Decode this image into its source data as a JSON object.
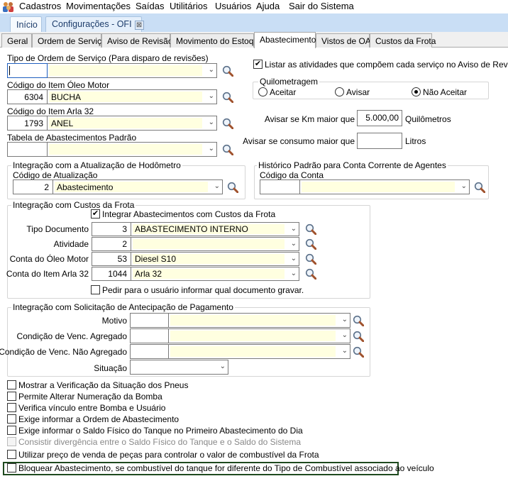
{
  "menu": {
    "items": [
      "Cadastros",
      "Movimentações",
      "Saídas",
      "Utilitários",
      "Usuários",
      "Ajuda",
      "Sair do Sistema"
    ]
  },
  "tabs": {
    "home": "Início",
    "config": "Configurações - OFI",
    "close": "⊠"
  },
  "subtabs": [
    "Geral",
    "Ordem de Serviço",
    "Aviso de Revisão",
    "Movimento do Estoque",
    "Abastecimento",
    "Vistos de OA",
    "Custos da Frota"
  ],
  "left": {
    "tipo_os": {
      "label": "Tipo de Ordem de Serviço (Para disparo de revisões)",
      "code": "",
      "desc": ""
    },
    "oleo": {
      "label": "Código do Item Óleo Motor",
      "code": "6304",
      "desc": "BUCHA"
    },
    "arla": {
      "label": "Código do Item Arla 32",
      "code": "1793",
      "desc": "ANEL"
    },
    "tabela": {
      "label": "Tabela de Abastecimentos Padrão",
      "code": "",
      "desc": ""
    }
  },
  "hodometro": {
    "legend": "Integração com a Atualização de Hodômetro",
    "label": "Código de Atualização",
    "code": "2",
    "desc": "Abastecimento"
  },
  "historico": {
    "legend": "Histórico Padrão para Conta Corrente de Agentes",
    "label": "Código da Conta",
    "code": "",
    "desc": ""
  },
  "listar": {
    "label": "Listar as atividades que compõem cada serviço no Aviso de Revisão",
    "checked": true
  },
  "quilometragem": {
    "legend": "Quilometragem",
    "options": [
      "Aceitar",
      "Avisar",
      "Não Aceitar"
    ],
    "selected": "Não Aceitar"
  },
  "km": {
    "label": "Avisar se Km maior que",
    "value": "5.000,00",
    "unit": "Quilômetros"
  },
  "consumo": {
    "label": "Avisar se consumo maior que",
    "value": "",
    "unit": "Litros"
  },
  "custos": {
    "legend": "Integração com Custos da Frota",
    "integrar": "Integrar Abastecimentos com Custos da Frota",
    "rows": [
      {
        "label": "Tipo Documento",
        "code": "3",
        "desc": "ABASTECIMENTO INTERNO"
      },
      {
        "label": "Atividade",
        "code": "2",
        "desc": ""
      },
      {
        "label": "Conta do Óleo Motor",
        "code": "53",
        "desc": "Diesel S10"
      },
      {
        "label": "Conta do Item Arla 32",
        "code": "1044",
        "desc": "Arla 32"
      }
    ],
    "pedir": "Pedir para o usuário informar qual documento gravar."
  },
  "antecipacao": {
    "legend": "Integração com Solicitação de Antecipação de Pagamento",
    "rows": [
      {
        "label": "Motivo"
      },
      {
        "label": "Condição de Venc. Agregado"
      },
      {
        "label": "Condição de Venc. Não Agregado"
      }
    ],
    "situacao": "Situação"
  },
  "options": [
    "Mostrar a Verificação da Situação dos Pneus",
    "Permite Alterar Numeração da Bomba",
    "Verifica vínculo entre Bomba e Usuário",
    "Exige informar a Ordem de Abastecimento",
    "Exige informar o Saldo Físico do Tanque no Primeiro Abastecimento do Dia",
    "Consistir divergência entre o Saldo Físico do Tanque e o Saldo do Sistema",
    "Utilizar preço de venda de peças para controlar o valor de combustível da Frota",
    "Bloquear Abastecimento, se combustível do tanque for diferente do Tipo de Combustível associado ao veículo"
  ],
  "colors": {
    "highlight": "#1f4a1f",
    "field_yellow": "#ffffe0",
    "tab_strip": "#c9def5"
  }
}
